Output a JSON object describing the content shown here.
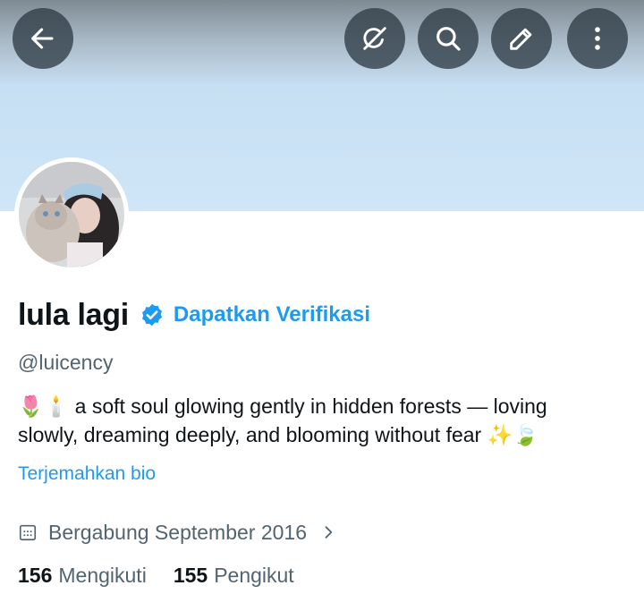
{
  "header": {
    "back_icon": "arrow-left-icon",
    "grok_icon": "grok-icon",
    "search_icon": "search-icon",
    "edit_icon": "pencil-icon",
    "more_icon": "vertical-dots-icon",
    "banner_color": "#cfe6f8",
    "button_color": "#2f3c47"
  },
  "profile": {
    "display_name": "lula lagi",
    "verified_icon": "verified-badge-icon",
    "get_verified_label": "Dapatkan Verifikasi",
    "handle": "@luicency",
    "bio_line_1": "🌷🕯️ a soft soul glowing gently in hidden forests — loving",
    "bio_line_2": "slowly, dreaming deeply, and blooming without fear ✨🍃",
    "translate_label": "Terjemahkan bio",
    "joined_icon": "calendar-icon",
    "joined_text": "Bergabung September 2016",
    "joined_chevron_icon": "chevron-right-icon"
  },
  "stats": {
    "following_count": "156",
    "following_label": "Mengikuti",
    "followers_count": "155",
    "followers_label": "Pengikut"
  },
  "colors": {
    "accent": "#1d9bf0",
    "secondary_text": "#536471",
    "primary_text": "#0f1419"
  }
}
